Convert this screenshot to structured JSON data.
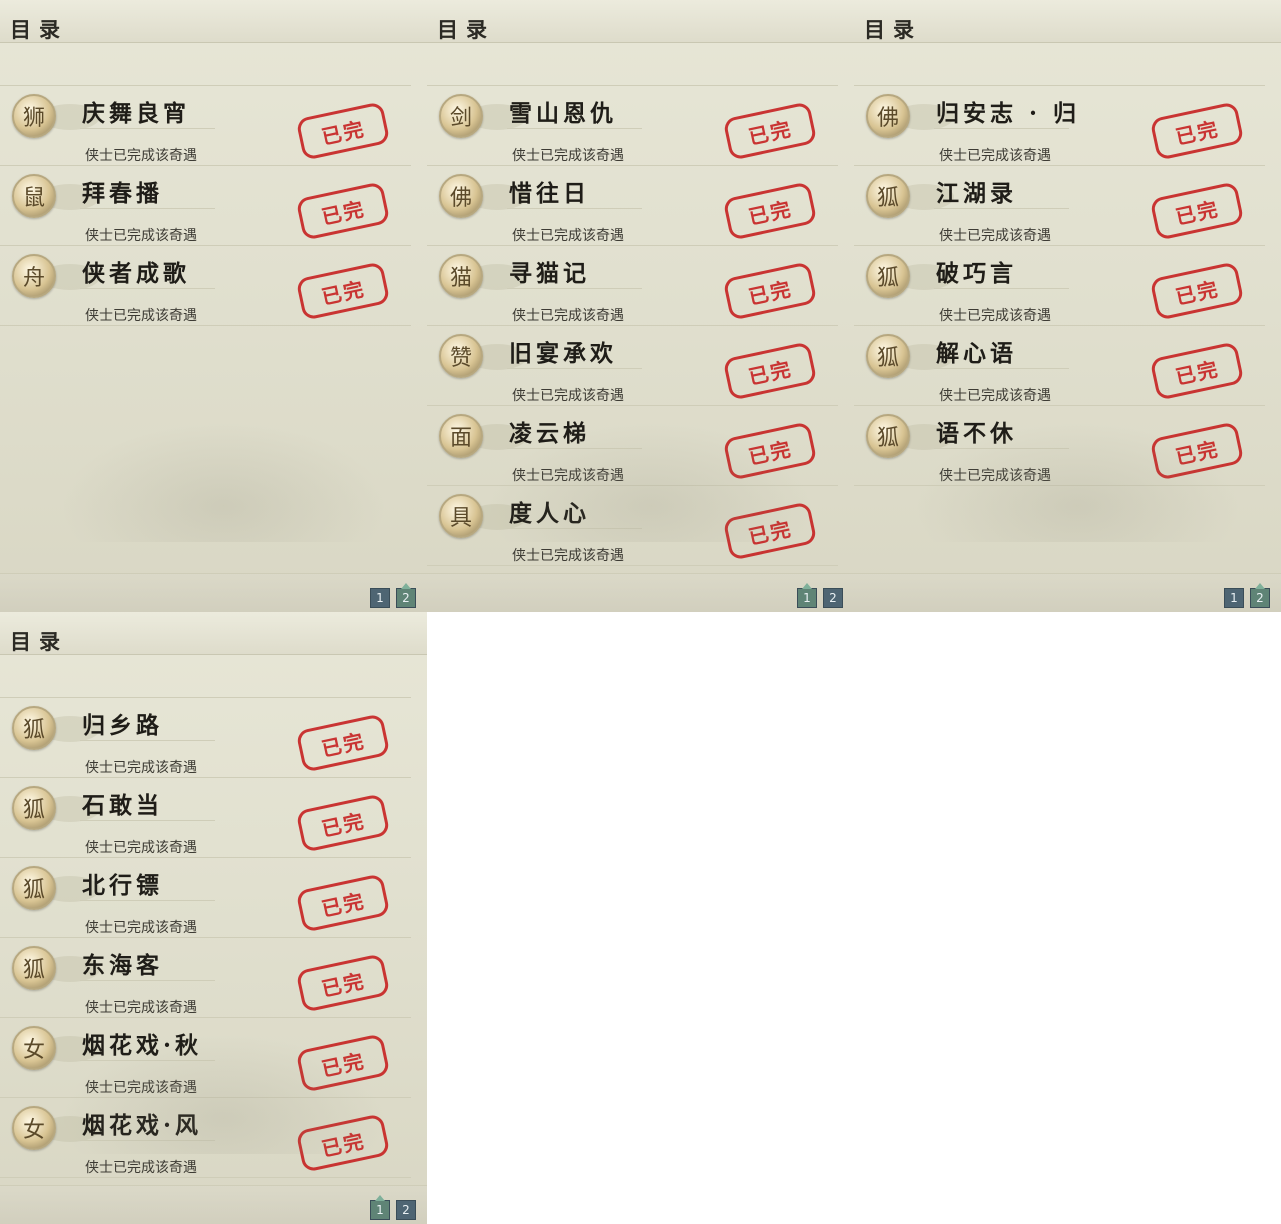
{
  "panels": [
    {
      "title": "目录",
      "pages": [
        "1",
        "2"
      ],
      "active_page": "2",
      "items": [
        {
          "title": "庆舞良宵",
          "status": "侠士已完成该奇遇",
          "stamp": "已完",
          "icon": "lion-dance-icon",
          "glyph": "狮"
        },
        {
          "title": "拜春播",
          "status": "侠士已完成该奇遇",
          "stamp": "已完",
          "icon": "kangaroo-icon",
          "glyph": "鼠"
        },
        {
          "title": "侠者成歌",
          "status": "侠士已完成该奇遇",
          "stamp": "已完",
          "icon": "fishing-boat-icon",
          "glyph": "舟"
        }
      ]
    },
    {
      "title": "目录",
      "pages": [
        "1",
        "2"
      ],
      "active_page": "1",
      "items": [
        {
          "title": "雪山恩仇",
          "status": "侠士已完成该奇遇",
          "stamp": "已完",
          "icon": "sword-icon",
          "glyph": "剑"
        },
        {
          "title": "惜往日",
          "status": "侠士已完成该奇遇",
          "stamp": "已完",
          "icon": "golden-buddha-icon",
          "glyph": "佛"
        },
        {
          "title": "寻猫记",
          "status": "侠士已完成该奇遇",
          "stamp": "已完",
          "icon": "cat-icon",
          "glyph": "猫"
        },
        {
          "title": "旧宴承欢",
          "status": "侠士已完成该奇遇",
          "stamp": "已完",
          "icon": "thumbs-up-icon",
          "glyph": "赞"
        },
        {
          "title": "凌云梯",
          "status": "侠士已完成该奇遇",
          "stamp": "已完",
          "icon": "face-icon",
          "glyph": "面"
        },
        {
          "title": "度人心",
          "status": "侠士已完成该奇遇",
          "stamp": "已完",
          "icon": "mask-icon",
          "glyph": "具"
        }
      ]
    },
    {
      "title": "目录",
      "pages": [
        "1",
        "2"
      ],
      "active_page": "2",
      "items": [
        {
          "title": "归安志 · 归",
          "status": "侠士已完成该奇遇",
          "stamp": "已完",
          "icon": "golden-buddha-icon",
          "glyph": "佛"
        },
        {
          "title": "江湖录",
          "status": "侠士已完成该奇遇",
          "stamp": "已完",
          "icon": "fox-icon",
          "glyph": "狐"
        },
        {
          "title": "破巧言",
          "status": "侠士已完成该奇遇",
          "stamp": "已完",
          "icon": "fox-icon",
          "glyph": "狐"
        },
        {
          "title": "解心语",
          "status": "侠士已完成该奇遇",
          "stamp": "已完",
          "icon": "fox-icon",
          "glyph": "狐"
        },
        {
          "title": "语不休",
          "status": "侠士已完成该奇遇",
          "stamp": "已完",
          "icon": "fox-icon",
          "glyph": "狐"
        }
      ]
    },
    {
      "title": "目录",
      "pages": [
        "1",
        "2"
      ],
      "active_page": "1",
      "items": [
        {
          "title": "归乡路",
          "status": "侠士已完成该奇遇",
          "stamp": "已完",
          "icon": "fox-icon",
          "glyph": "狐"
        },
        {
          "title": "石敢当",
          "status": "侠士已完成该奇遇",
          "stamp": "已完",
          "icon": "fox-icon",
          "glyph": "狐"
        },
        {
          "title": "北行镖",
          "status": "侠士已完成该奇遇",
          "stamp": "已完",
          "icon": "fox-icon",
          "glyph": "狐"
        },
        {
          "title": "东海客",
          "status": "侠士已完成该奇遇",
          "stamp": "已完",
          "icon": "fox-icon",
          "glyph": "狐"
        },
        {
          "title": "烟花戏·秋",
          "status": "侠士已完成该奇遇",
          "stamp": "已完",
          "icon": "lady-portrait-icon",
          "glyph": "女"
        },
        {
          "title": "烟花戏·风",
          "status": "侠士已完成该奇遇",
          "stamp": "已完",
          "icon": "lady-portrait-icon",
          "glyph": "女"
        }
      ]
    }
  ]
}
